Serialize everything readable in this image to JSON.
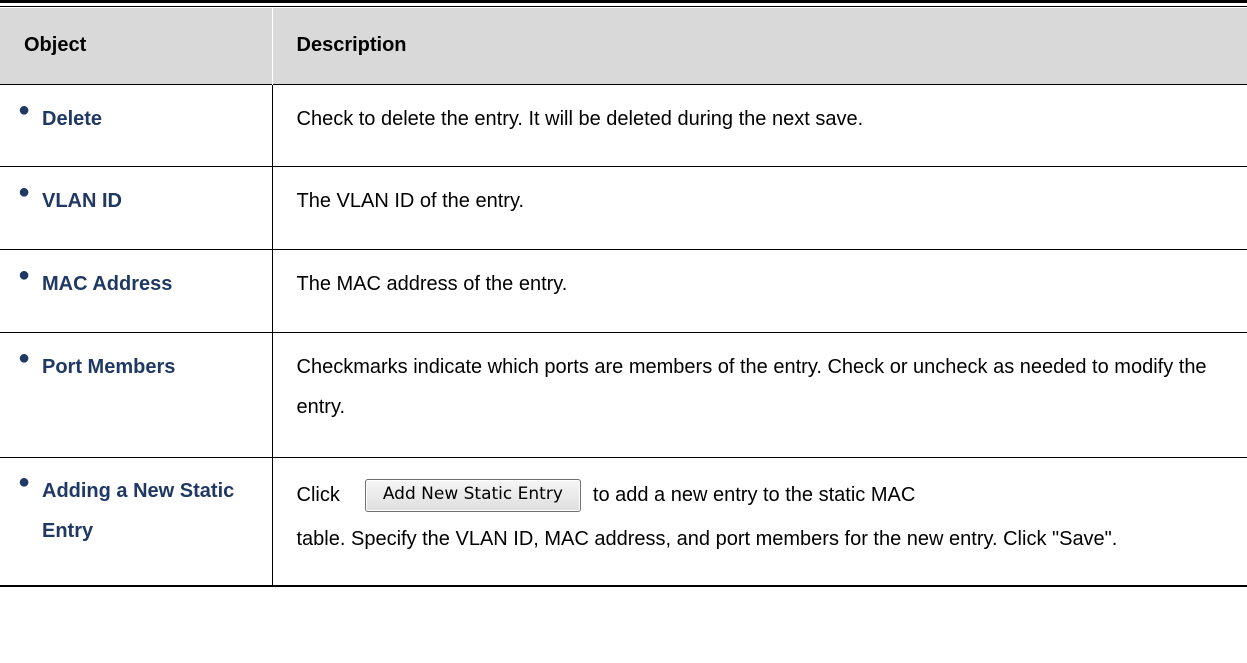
{
  "table": {
    "headers": {
      "object": "Object",
      "description": "Description"
    },
    "rows": [
      {
        "object": "Delete",
        "description": "Check to delete the entry. It will be deleted during the next save."
      },
      {
        "object": "VLAN ID",
        "description": "The VLAN ID of the entry."
      },
      {
        "object": "MAC Address",
        "description": "The MAC address of the entry."
      },
      {
        "object": "Port Members",
        "description": "Checkmarks indicate which ports are members of the entry. Check or uncheck as needed to modify the entry."
      },
      {
        "object_line1": "Adding a New Static",
        "object_line2": "Entry",
        "click_prefix": "Click",
        "button_label": "Add New Static Entry",
        "after_button": "to add a new entry to the static MAC",
        "description_rest": "table. Specify the VLAN ID, MAC address, and port members for the new entry. Click \"Save\"."
      }
    ]
  },
  "bullet_icon": "bullet-icon",
  "colors": {
    "header_bg": "#d9d9d9",
    "object_text": "#1f3864"
  }
}
